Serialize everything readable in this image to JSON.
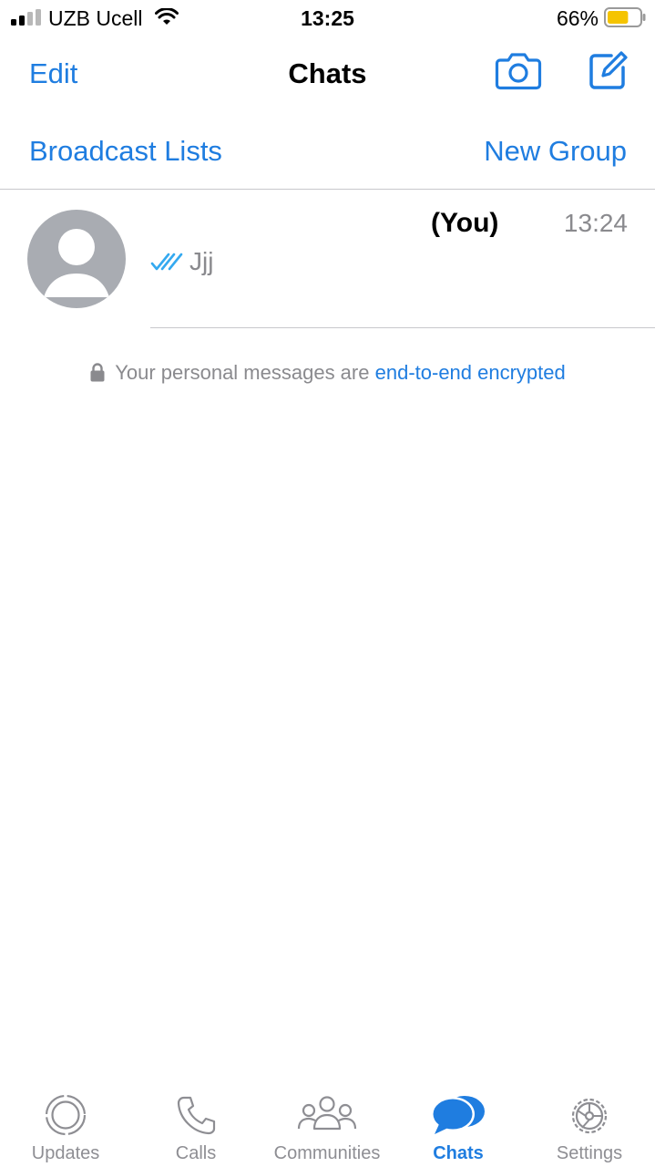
{
  "status_bar": {
    "carrier": "UZB Ucell",
    "time": "13:25",
    "battery_percent": "66%",
    "battery_level": 0.66,
    "battery_color": "#f5c400"
  },
  "nav": {
    "edit_label": "Edit",
    "title": "Chats",
    "camera_icon": "camera-icon",
    "compose_icon": "compose-icon"
  },
  "actions": {
    "broadcast_label": "Broadcast Lists",
    "new_group_label": "New Group"
  },
  "chats": [
    {
      "name": "(You)",
      "time": "13:24",
      "preview": "Jjj",
      "status_icon": "double-check-icon",
      "avatar_icon": "default-avatar-icon"
    }
  ],
  "encryption_notice": {
    "text": "Your personal messages are",
    "link": "end-to-end encrypted",
    "icon": "lock-icon"
  },
  "tabs": [
    {
      "label": "Updates",
      "icon": "updates-icon",
      "active": false
    },
    {
      "label": "Calls",
      "icon": "phone-icon",
      "active": false
    },
    {
      "label": "Communities",
      "icon": "communities-icon",
      "active": false
    },
    {
      "label": "Chats",
      "icon": "chat-bubbles-icon",
      "active": true
    },
    {
      "label": "Settings",
      "icon": "gear-icon",
      "active": false
    }
  ],
  "colors": {
    "accent": "#1f7de0",
    "secondary_text": "#8a8a8e",
    "avatar_bg": "#a9acb2",
    "divider": "#c8c8cc"
  }
}
